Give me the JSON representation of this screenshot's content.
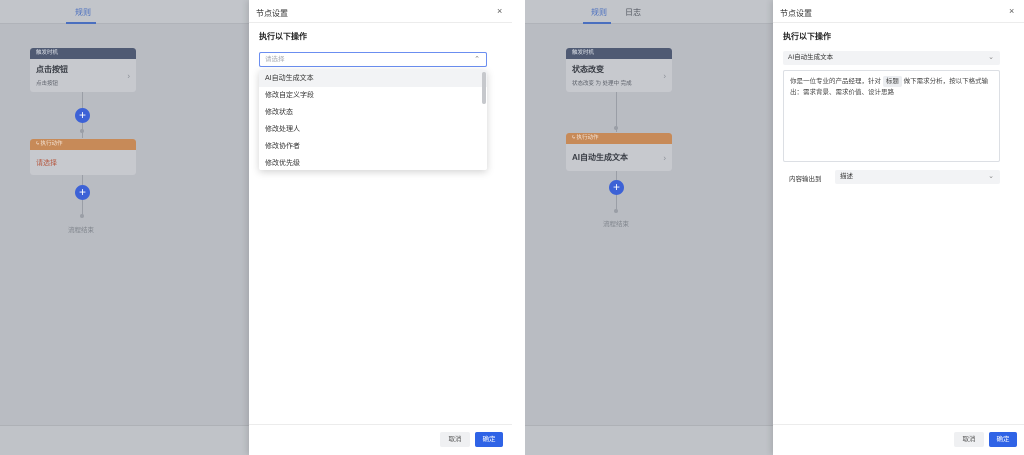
{
  "left": {
    "tabs": [
      {
        "label": "规则"
      }
    ],
    "trigger_node": {
      "header": "触发时机",
      "title": "点击按钮",
      "subtitle": "点击按钮"
    },
    "action_node": {
      "header": "执行动作",
      "placeholder": "请选择"
    },
    "end_label": "流程结束",
    "drawer": {
      "title": "节点设置",
      "close": "×",
      "section_title": "执行以下操作",
      "select": {
        "placeholder": "请选择"
      },
      "dropdown_options": [
        "AI自动生成文本",
        "修改自定义字段",
        "修改状态",
        "修改处理人",
        "修改协作者",
        "修改优先级"
      ],
      "cancel_label": "取消",
      "ok_label": "确定"
    }
  },
  "right": {
    "tabs": [
      {
        "label": "规则"
      },
      {
        "label": "日志"
      }
    ],
    "trigger_node": {
      "header": "触发时机",
      "title": "状态改变",
      "subtitle": "状态改变 为 处理中 完成"
    },
    "action_node": {
      "header": "执行动作",
      "title": "AI自动生成文本"
    },
    "end_label": "流程结束",
    "drawer": {
      "title": "节点设置",
      "close": "×",
      "section_title": "执行以下操作",
      "action_select": "AI自动生成文本",
      "prompt_before": "你是一位专业的产品经理，针对",
      "prompt_tag": "标题",
      "prompt_after": "做下需求分析，按以下格式输出：需求背景、需求价值、设计思路",
      "output_label": "内容输出到",
      "output_select": "描述",
      "cancel_label": "取消",
      "ok_label": "确定"
    }
  },
  "colors": {
    "primary": "#2f63e6",
    "overlay": "#b9bcc2",
    "plus": "#3d62d6"
  }
}
